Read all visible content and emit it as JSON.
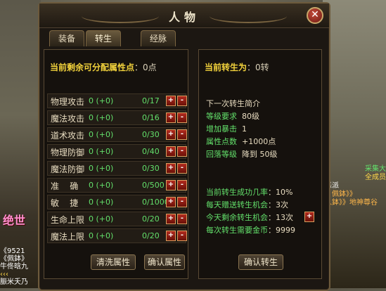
{
  "window": {
    "title": "人物",
    "close_icon": "close-icon"
  },
  "tabs": [
    {
      "label": "装备"
    },
    {
      "label": "转生",
      "active": true
    },
    {
      "label": "经脉"
    }
  ],
  "left": {
    "points_label": "当前剩余可分配属性点",
    "points_value": "：0点",
    "stats": [
      {
        "name": "物理攻击",
        "value": "0 (+0)",
        "max": "0/17"
      },
      {
        "name": "魔法攻击",
        "value": "0 (+0)",
        "max": "0/16"
      },
      {
        "name": "道术攻击",
        "value": "0 (+0)",
        "max": "0/30"
      },
      {
        "name": "物理防御",
        "value": "0 (+0)",
        "max": "0/40"
      },
      {
        "name": "魔法防御",
        "value": "0 (+0)",
        "max": "0/30"
      },
      {
        "name": "准    确",
        "value": "0 (+0)",
        "max": "0/500"
      },
      {
        "name": "敏    捷",
        "value": "0 (+0)",
        "max": "0/1000"
      },
      {
        "name": "生命上限",
        "value": "0 (+0)",
        "max": "0/20"
      },
      {
        "name": "魔法上限",
        "value": "0 (+0)",
        "max": "0/20"
      }
    ],
    "plus": "+",
    "minus": "-",
    "wash_button": "清洗属性",
    "confirm_button": "确认属性"
  },
  "right": {
    "rebirth_label": "当前转生为",
    "rebirth_value": "：0转",
    "next_title": "下一次转生简介",
    "next_items": [
      {
        "k": "等级要求",
        "v": "80级"
      },
      {
        "k": "增加暴击",
        "v": "1"
      },
      {
        "k": "属性点数",
        "v": "+1000点"
      },
      {
        "k": "回落等级",
        "v": "降到 50级"
      }
    ],
    "info_items": [
      {
        "k": "当前转生成功几率",
        "v": "10%"
      },
      {
        "k": "每天赠送转生机会",
        "v": "3次"
      },
      {
        "k": "今天剩余转生机会",
        "v": "13次"
      },
      {
        "k": "每次转生需要金币",
        "v": "9999"
      }
    ],
    "plus": "+",
    "confirm_button": "确认转生"
  },
  "background": {
    "left_big": "绝世",
    "left_text": [
      "《9521",
      "《佩鉢》",
      "牛佟晗九",
      "‹‹‹",
      "脤米夭乃"
    ],
    "right_text": [
      "采集大",
      "全成员",
      "恶派",
      "》佩鉢》》",
      "八鉢》》地神尊谷"
    ]
  }
}
